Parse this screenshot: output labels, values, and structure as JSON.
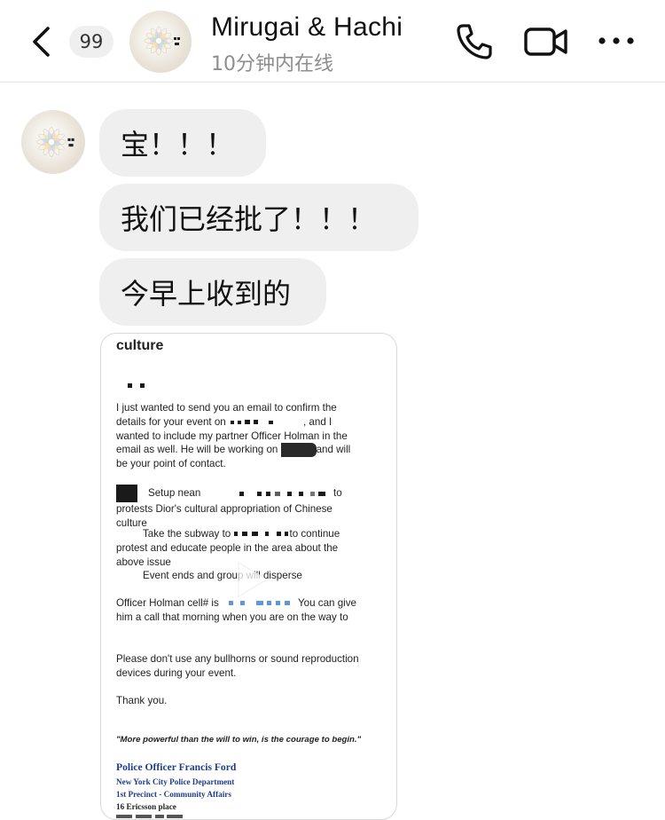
{
  "header": {
    "unread_count": "99",
    "title": "Mirugai & Hachi",
    "status": "10分钟内在线"
  },
  "messages": [
    {
      "text": "宝！！！"
    },
    {
      "text": "我们已经批了！！！"
    },
    {
      "text": "今早上收到的"
    }
  ],
  "attachment": {
    "heading": "culture",
    "p1_line1": "I just wanted to send you an email to confirm the",
    "p1_line2a": "details for your event on",
    "p1_line2b": ", and I",
    "p1_line3": "wanted to include my partner Officer Holman in the",
    "p1_line4a": "email as well. He will be working on",
    "p1_line4b": "and will",
    "p1_line5": "be your point of contact.",
    "p2_line1a": "Setup nean",
    "p2_line1b": "to",
    "p2_line2": "protests Dior's cultural appropriation of Chinese",
    "p2_line3": "culture",
    "p3_line1a": "Take the subway to",
    "p3_line1b": "to continue",
    "p3_line2": "protest and educate people in the area about the",
    "p3_line3": "above issue",
    "p4_line1": "Event ends and group will disperse",
    "p5_line1a": "Officer Holman cell# is",
    "p5_line1b": "You can give",
    "p5_line2": "him a call that morning when you are on the way to",
    "p6_line1": "Please don't use any bullhorns or sound reproduction",
    "p6_line2": "devices during your event.",
    "p7_line1": "Thank you.",
    "quote": "\"More powerful than the will to win, is the courage to begin.\"",
    "signature_name": "Police Officer Francis Ford",
    "signature_line1": "New York City Police Department",
    "signature_line2": "1st Precinct - Community Affairs",
    "signature_line3": "16 Ericsson place"
  },
  "icons": {
    "back": "chevron-left-icon",
    "call": "phone-icon",
    "video": "video-camera-icon",
    "more": "more-horizontal-icon",
    "play": "play-icon"
  }
}
